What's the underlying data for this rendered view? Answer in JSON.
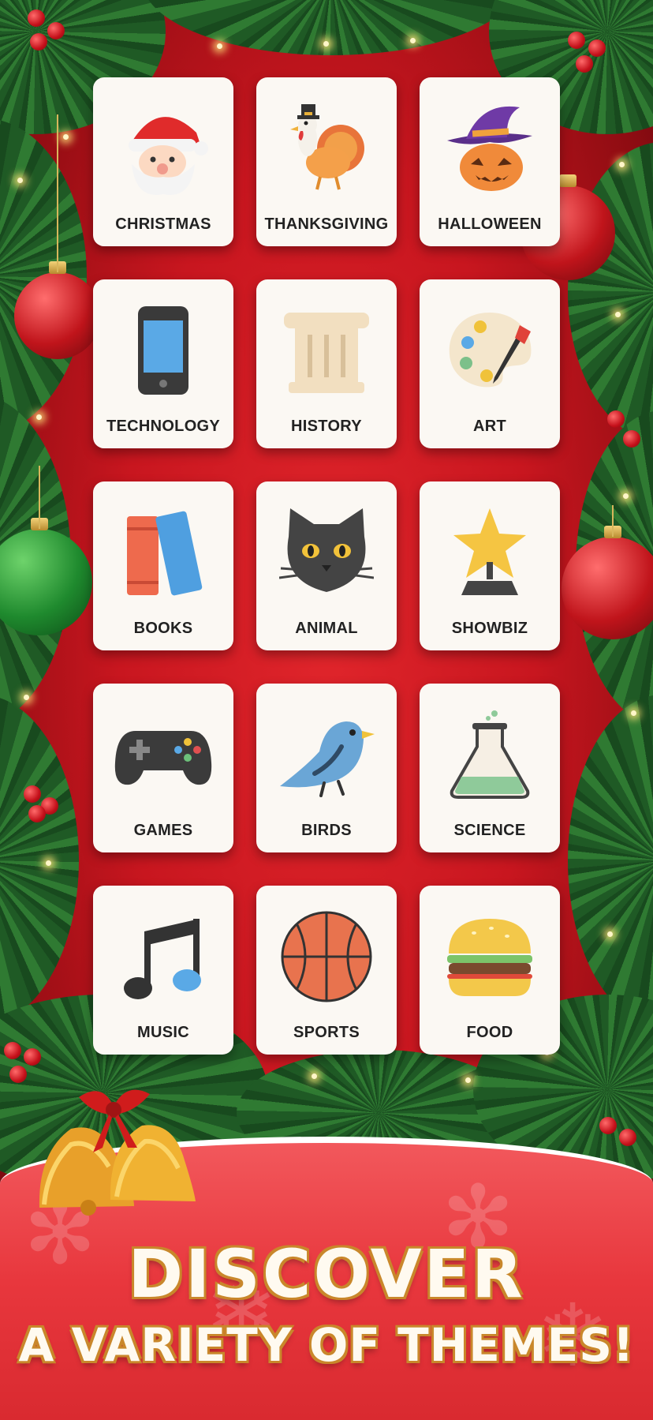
{
  "themes": [
    {
      "label": "CHRISTMAS",
      "icon": "santa-icon"
    },
    {
      "label": "THANKSGIVING",
      "icon": "turkey-icon"
    },
    {
      "label": "HALLOWEEN",
      "icon": "pumpkin-witch-hat-icon"
    },
    {
      "label": "TECHNOLOGY",
      "icon": "smartphone-icon"
    },
    {
      "label": "HISTORY",
      "icon": "column-icon"
    },
    {
      "label": "ART",
      "icon": "palette-icon"
    },
    {
      "label": "BOOKS",
      "icon": "books-icon"
    },
    {
      "label": "ANIMAL",
      "icon": "cat-icon"
    },
    {
      "label": "SHOWBIZ",
      "icon": "star-trophy-icon"
    },
    {
      "label": "GAMES",
      "icon": "gamepad-icon"
    },
    {
      "label": "BIRDS",
      "icon": "bird-icon"
    },
    {
      "label": "SCIENCE",
      "icon": "flask-icon"
    },
    {
      "label": "MUSIC",
      "icon": "music-note-icon"
    },
    {
      "label": "SPORTS",
      "icon": "basketball-icon"
    },
    {
      "label": "FOOD",
      "icon": "burger-icon"
    }
  ],
  "banner": {
    "line1": "DISCOVER",
    "line2": "A VARIETY OF THEMES!"
  },
  "colors": {
    "background": "#c8161f",
    "tile": "#fbf8f3",
    "banner": "#e8373d",
    "text_outline": "#c9872b"
  }
}
